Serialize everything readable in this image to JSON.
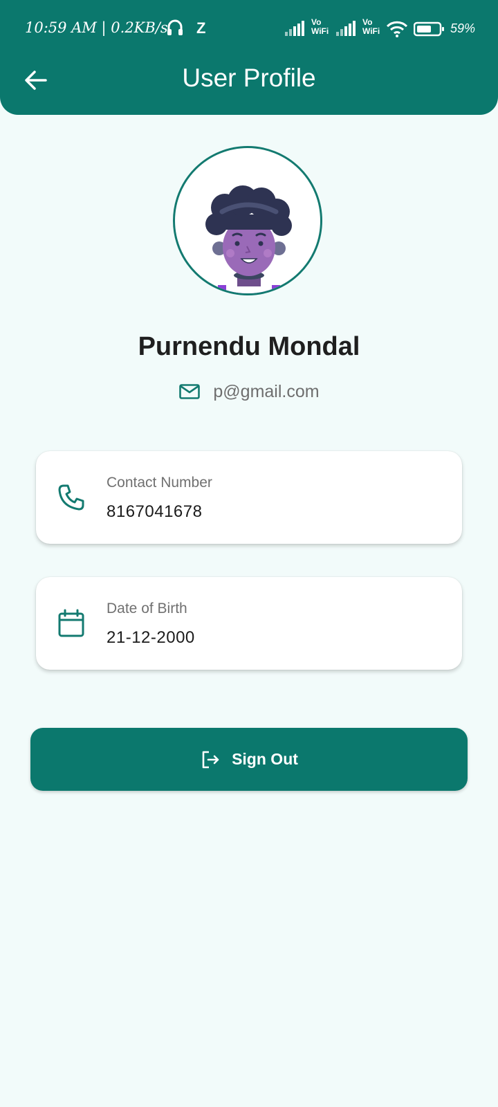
{
  "status_bar": {
    "time_text": "10:59 AM | 0.2KB/s",
    "extra_glyph": "Z",
    "network_label_1": "Vo\nWiFi",
    "network_label_2": "Vo\nWiFi",
    "battery_percent": "59%",
    "icons": [
      "headset-icon",
      "signal-icon",
      "wifi-icon",
      "battery-icon"
    ]
  },
  "header": {
    "title": "User Profile",
    "back_icon": "arrow-left-icon"
  },
  "profile": {
    "name": "Purnendu Mondal",
    "email": "p@gmail.com",
    "email_icon": "mail-icon",
    "avatar_icon": "avatar-illustration"
  },
  "cards": [
    {
      "label": "Contact Number",
      "value": "8167041678",
      "icon": "phone-icon"
    },
    {
      "label": "Date of Birth",
      "value": "21-12-2000",
      "icon": "calendar-icon"
    }
  ],
  "actions": {
    "sign_out_label": "Sign Out",
    "sign_out_icon": "logout-icon"
  },
  "colors": {
    "primary": "#0b786d",
    "background": "#f2fbfa",
    "card": "#ffffff",
    "text_dark": "#1f1f1f",
    "text_muted": "#707070"
  }
}
